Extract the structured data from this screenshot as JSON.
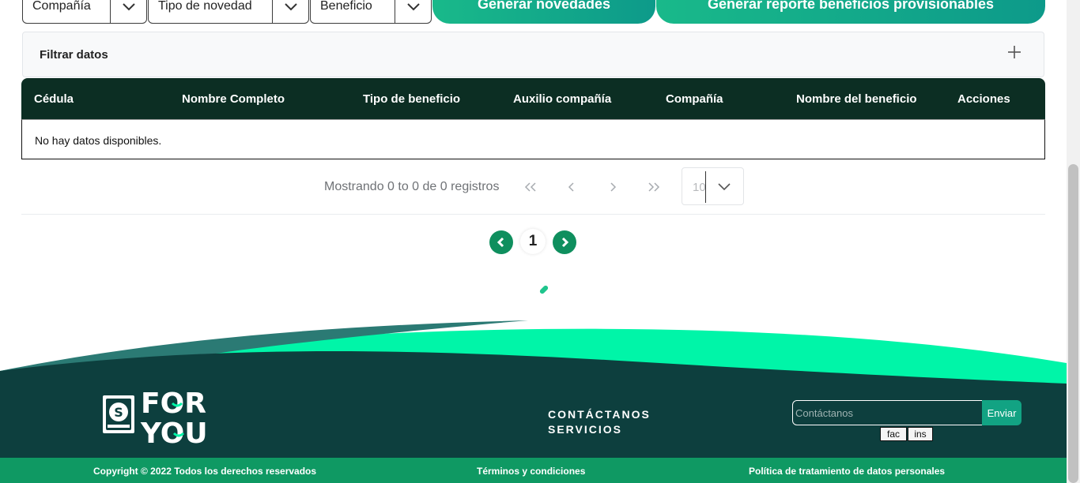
{
  "filters": {
    "company": "Compañía",
    "novelty_type": "Tipo de novedad",
    "benefit": "Beneficio",
    "generate_button": "Generar novedades",
    "report_button": "Generar reporte beneficios provisionables"
  },
  "filter_panel": {
    "title": "Filtrar datos"
  },
  "table": {
    "columns": [
      "Cédula",
      "Nombre Completo",
      "Tipo de beneficio",
      "Auxilio compañía",
      "Compañía",
      "Nombre del beneficio",
      "Acciones"
    ],
    "empty_message": "No hay datos disponibles."
  },
  "pagination": {
    "info": "Mostrando 0 to 0 de 0 registros",
    "page_size": "10",
    "current_page": "1"
  },
  "footer": {
    "logo_text": "FOR YOU",
    "links": [
      "CONTÁCTANOS",
      "SERVICIOS"
    ],
    "contact_placeholder": "Contáctanos",
    "send_label": "Enviar",
    "social": [
      "fac",
      "ins"
    ],
    "copyright": "Copyright © 2022 Todos los derechos reservados",
    "terms": "Términos y condiciones",
    "privacy": "Política de tratamiento de datos personales"
  },
  "colors": {
    "header_dark": "#0c2e23",
    "accent_green": "#0f9963",
    "footer_dark": "#0d3f3e",
    "wave_bright": "#00f5a8"
  },
  "icons": [
    "chevron-down-icon",
    "plus-icon",
    "double-chevron-left-icon",
    "chevron-left-icon",
    "chevron-right-icon",
    "double-chevron-right-icon",
    "logo-mark"
  ]
}
